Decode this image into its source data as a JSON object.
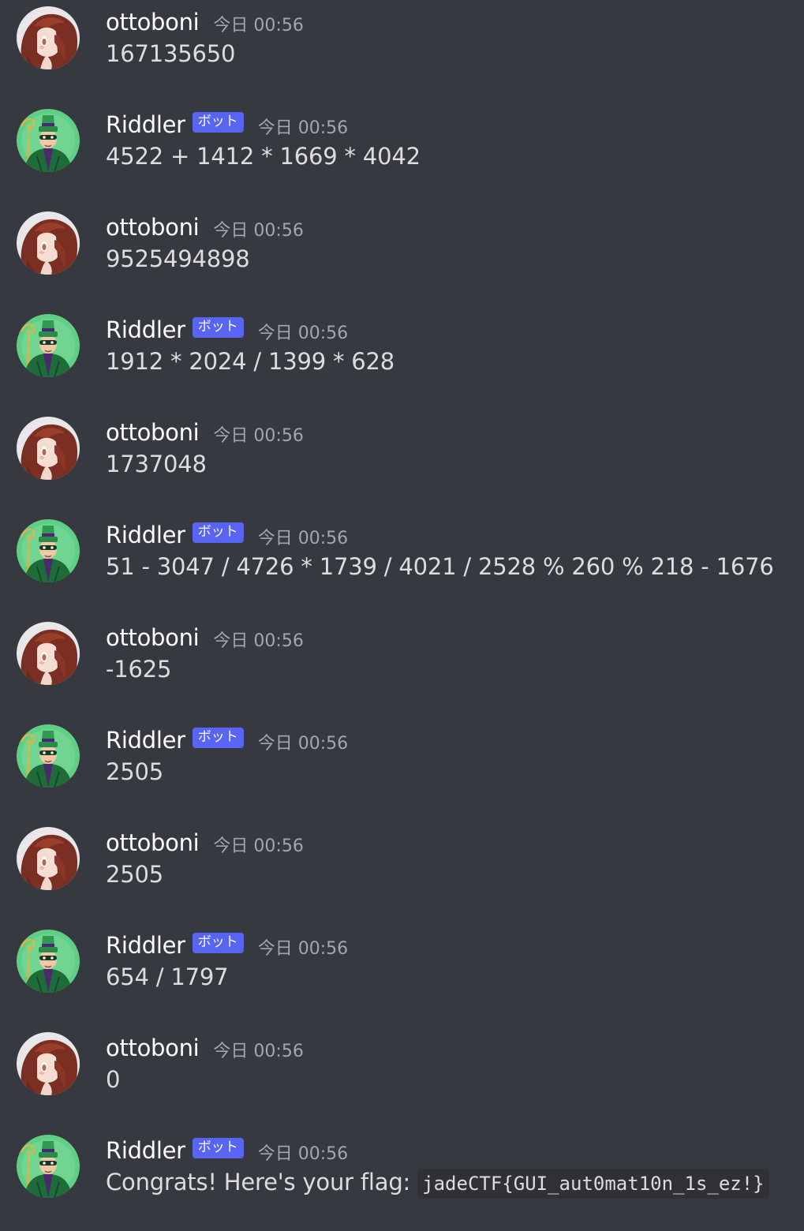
{
  "channel": {
    "bot_tag_label": "ボット",
    "messages": [
      {
        "author": "ottoboni",
        "avatar": "ottoboni-avatar-icon",
        "bot": false,
        "timestamp": "今日 00:56",
        "text": "167135650"
      },
      {
        "author": "Riddler",
        "avatar": "riddler-avatar-icon",
        "bot": true,
        "timestamp": "今日 00:56",
        "text": "4522 + 1412 * 1669 * 4042"
      },
      {
        "author": "ottoboni",
        "avatar": "ottoboni-avatar-icon",
        "bot": false,
        "timestamp": "今日 00:56",
        "text": "9525494898"
      },
      {
        "author": "Riddler",
        "avatar": "riddler-avatar-icon",
        "bot": true,
        "timestamp": "今日 00:56",
        "text": "1912 * 2024 / 1399 * 628"
      },
      {
        "author": "ottoboni",
        "avatar": "ottoboni-avatar-icon",
        "bot": false,
        "timestamp": "今日 00:56",
        "text": "1737048"
      },
      {
        "author": "Riddler",
        "avatar": "riddler-avatar-icon",
        "bot": true,
        "timestamp": "今日 00:56",
        "text": "51 - 3047 / 4726 * 1739 / 4021 / 2528 % 260 % 218 - 1676"
      },
      {
        "author": "ottoboni",
        "avatar": "ottoboni-avatar-icon",
        "bot": false,
        "timestamp": "今日 00:56",
        "text": "-1625"
      },
      {
        "author": "Riddler",
        "avatar": "riddler-avatar-icon",
        "bot": true,
        "timestamp": "今日 00:56",
        "text": "2505"
      },
      {
        "author": "ottoboni",
        "avatar": "ottoboni-avatar-icon",
        "bot": false,
        "timestamp": "今日 00:56",
        "text": "2505"
      },
      {
        "author": "Riddler",
        "avatar": "riddler-avatar-icon",
        "bot": true,
        "timestamp": "今日 00:56",
        "text": "654 / 1797"
      },
      {
        "author": "ottoboni",
        "avatar": "ottoboni-avatar-icon",
        "bot": false,
        "timestamp": "今日 00:56",
        "text": "0"
      },
      {
        "author": "Riddler",
        "avatar": "riddler-avatar-icon",
        "bot": true,
        "timestamp": "今日 00:56",
        "text": "Congrats! Here's your flag:",
        "code": "jadeCTF{GUI_aut0mat10n_1s_ez!}"
      }
    ]
  },
  "colors": {
    "background": "#36393f",
    "username": "#ffffff",
    "message_text": "#dcddde",
    "timestamp": "#a3a6aa",
    "bot_tag": "#5865f2",
    "code_background": "#2f3136"
  }
}
